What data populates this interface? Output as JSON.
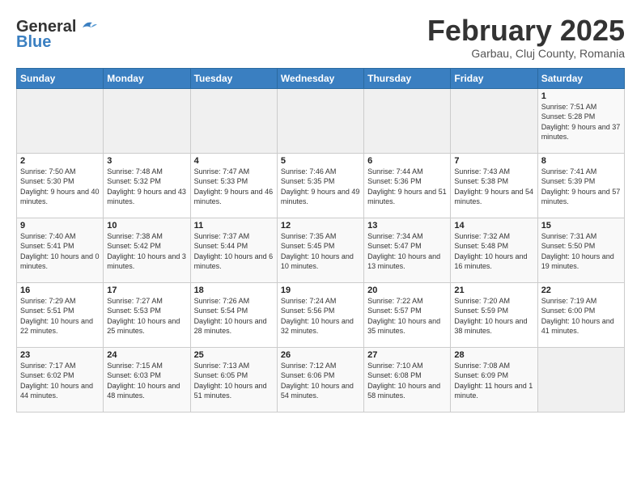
{
  "header": {
    "logo_general": "General",
    "logo_blue": "Blue",
    "month_title": "February 2025",
    "location": "Garbau, Cluj County, Romania"
  },
  "weekdays": [
    "Sunday",
    "Monday",
    "Tuesday",
    "Wednesday",
    "Thursday",
    "Friday",
    "Saturday"
  ],
  "weeks": [
    [
      {
        "day": "",
        "info": ""
      },
      {
        "day": "",
        "info": ""
      },
      {
        "day": "",
        "info": ""
      },
      {
        "day": "",
        "info": ""
      },
      {
        "day": "",
        "info": ""
      },
      {
        "day": "",
        "info": ""
      },
      {
        "day": "1",
        "info": "Sunrise: 7:51 AM\nSunset: 5:28 PM\nDaylight: 9 hours and 37 minutes."
      }
    ],
    [
      {
        "day": "2",
        "info": "Sunrise: 7:50 AM\nSunset: 5:30 PM\nDaylight: 9 hours and 40 minutes."
      },
      {
        "day": "3",
        "info": "Sunrise: 7:48 AM\nSunset: 5:32 PM\nDaylight: 9 hours and 43 minutes."
      },
      {
        "day": "4",
        "info": "Sunrise: 7:47 AM\nSunset: 5:33 PM\nDaylight: 9 hours and 46 minutes."
      },
      {
        "day": "5",
        "info": "Sunrise: 7:46 AM\nSunset: 5:35 PM\nDaylight: 9 hours and 49 minutes."
      },
      {
        "day": "6",
        "info": "Sunrise: 7:44 AM\nSunset: 5:36 PM\nDaylight: 9 hours and 51 minutes."
      },
      {
        "day": "7",
        "info": "Sunrise: 7:43 AM\nSunset: 5:38 PM\nDaylight: 9 hours and 54 minutes."
      },
      {
        "day": "8",
        "info": "Sunrise: 7:41 AM\nSunset: 5:39 PM\nDaylight: 9 hours and 57 minutes."
      }
    ],
    [
      {
        "day": "9",
        "info": "Sunrise: 7:40 AM\nSunset: 5:41 PM\nDaylight: 10 hours and 0 minutes."
      },
      {
        "day": "10",
        "info": "Sunrise: 7:38 AM\nSunset: 5:42 PM\nDaylight: 10 hours and 3 minutes."
      },
      {
        "day": "11",
        "info": "Sunrise: 7:37 AM\nSunset: 5:44 PM\nDaylight: 10 hours and 6 minutes."
      },
      {
        "day": "12",
        "info": "Sunrise: 7:35 AM\nSunset: 5:45 PM\nDaylight: 10 hours and 10 minutes."
      },
      {
        "day": "13",
        "info": "Sunrise: 7:34 AM\nSunset: 5:47 PM\nDaylight: 10 hours and 13 minutes."
      },
      {
        "day": "14",
        "info": "Sunrise: 7:32 AM\nSunset: 5:48 PM\nDaylight: 10 hours and 16 minutes."
      },
      {
        "day": "15",
        "info": "Sunrise: 7:31 AM\nSunset: 5:50 PM\nDaylight: 10 hours and 19 minutes."
      }
    ],
    [
      {
        "day": "16",
        "info": "Sunrise: 7:29 AM\nSunset: 5:51 PM\nDaylight: 10 hours and 22 minutes."
      },
      {
        "day": "17",
        "info": "Sunrise: 7:27 AM\nSunset: 5:53 PM\nDaylight: 10 hours and 25 minutes."
      },
      {
        "day": "18",
        "info": "Sunrise: 7:26 AM\nSunset: 5:54 PM\nDaylight: 10 hours and 28 minutes."
      },
      {
        "day": "19",
        "info": "Sunrise: 7:24 AM\nSunset: 5:56 PM\nDaylight: 10 hours and 32 minutes."
      },
      {
        "day": "20",
        "info": "Sunrise: 7:22 AM\nSunset: 5:57 PM\nDaylight: 10 hours and 35 minutes."
      },
      {
        "day": "21",
        "info": "Sunrise: 7:20 AM\nSunset: 5:59 PM\nDaylight: 10 hours and 38 minutes."
      },
      {
        "day": "22",
        "info": "Sunrise: 7:19 AM\nSunset: 6:00 PM\nDaylight: 10 hours and 41 minutes."
      }
    ],
    [
      {
        "day": "23",
        "info": "Sunrise: 7:17 AM\nSunset: 6:02 PM\nDaylight: 10 hours and 44 minutes."
      },
      {
        "day": "24",
        "info": "Sunrise: 7:15 AM\nSunset: 6:03 PM\nDaylight: 10 hours and 48 minutes."
      },
      {
        "day": "25",
        "info": "Sunrise: 7:13 AM\nSunset: 6:05 PM\nDaylight: 10 hours and 51 minutes."
      },
      {
        "day": "26",
        "info": "Sunrise: 7:12 AM\nSunset: 6:06 PM\nDaylight: 10 hours and 54 minutes."
      },
      {
        "day": "27",
        "info": "Sunrise: 7:10 AM\nSunset: 6:08 PM\nDaylight: 10 hours and 58 minutes."
      },
      {
        "day": "28",
        "info": "Sunrise: 7:08 AM\nSunset: 6:09 PM\nDaylight: 11 hours and 1 minute."
      },
      {
        "day": "",
        "info": ""
      }
    ]
  ]
}
